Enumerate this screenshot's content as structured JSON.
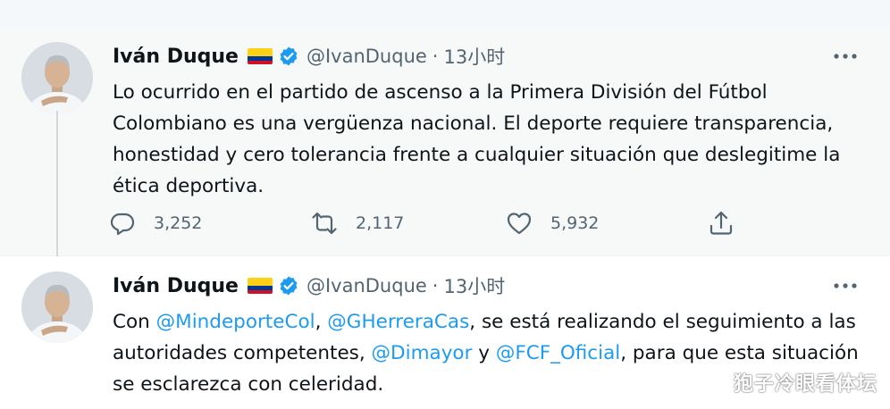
{
  "tweets": [
    {
      "author": "Iván Duque",
      "handle": "@IvanDuque",
      "separator": "·",
      "time": "13小时",
      "text": "Lo ocurrido en el partido de ascenso a la Primera División del Fútbol Colombiano es una vergüenza nacional. El deporte requiere transparencia, honestidad y cero tolerancia frente a cualquier situación que deslegitime la ética deportiva.",
      "replies": "3,252",
      "retweets": "2,117",
      "likes": "5,932"
    },
    {
      "author": "Iván Duque",
      "handle": "@IvanDuque",
      "separator": "·",
      "time": "13小时",
      "text_parts": {
        "p1": "Con ",
        "m1": "@MindeporteCol",
        "p2": ", ",
        "m2": "@GHerreraCas",
        "p3": ", se está realizando el seguimiento a las autoridades competentes, ",
        "m3": "@Dimayor",
        "p4": " y ",
        "m4": "@FCF_Oficial",
        "p5": ", para que esta situación se esclarezca con celeridad."
      }
    }
  ],
  "watermark": "狍子冷眼看体坛",
  "icons": [
    "flag-colombia-icon",
    "verified-badge-icon",
    "more-options-icon",
    "reply-icon",
    "retweet-icon",
    "like-icon",
    "share-icon"
  ],
  "colors": {
    "accent": "#1d9bf0",
    "text": "#0f1419",
    "muted": "#536471"
  }
}
